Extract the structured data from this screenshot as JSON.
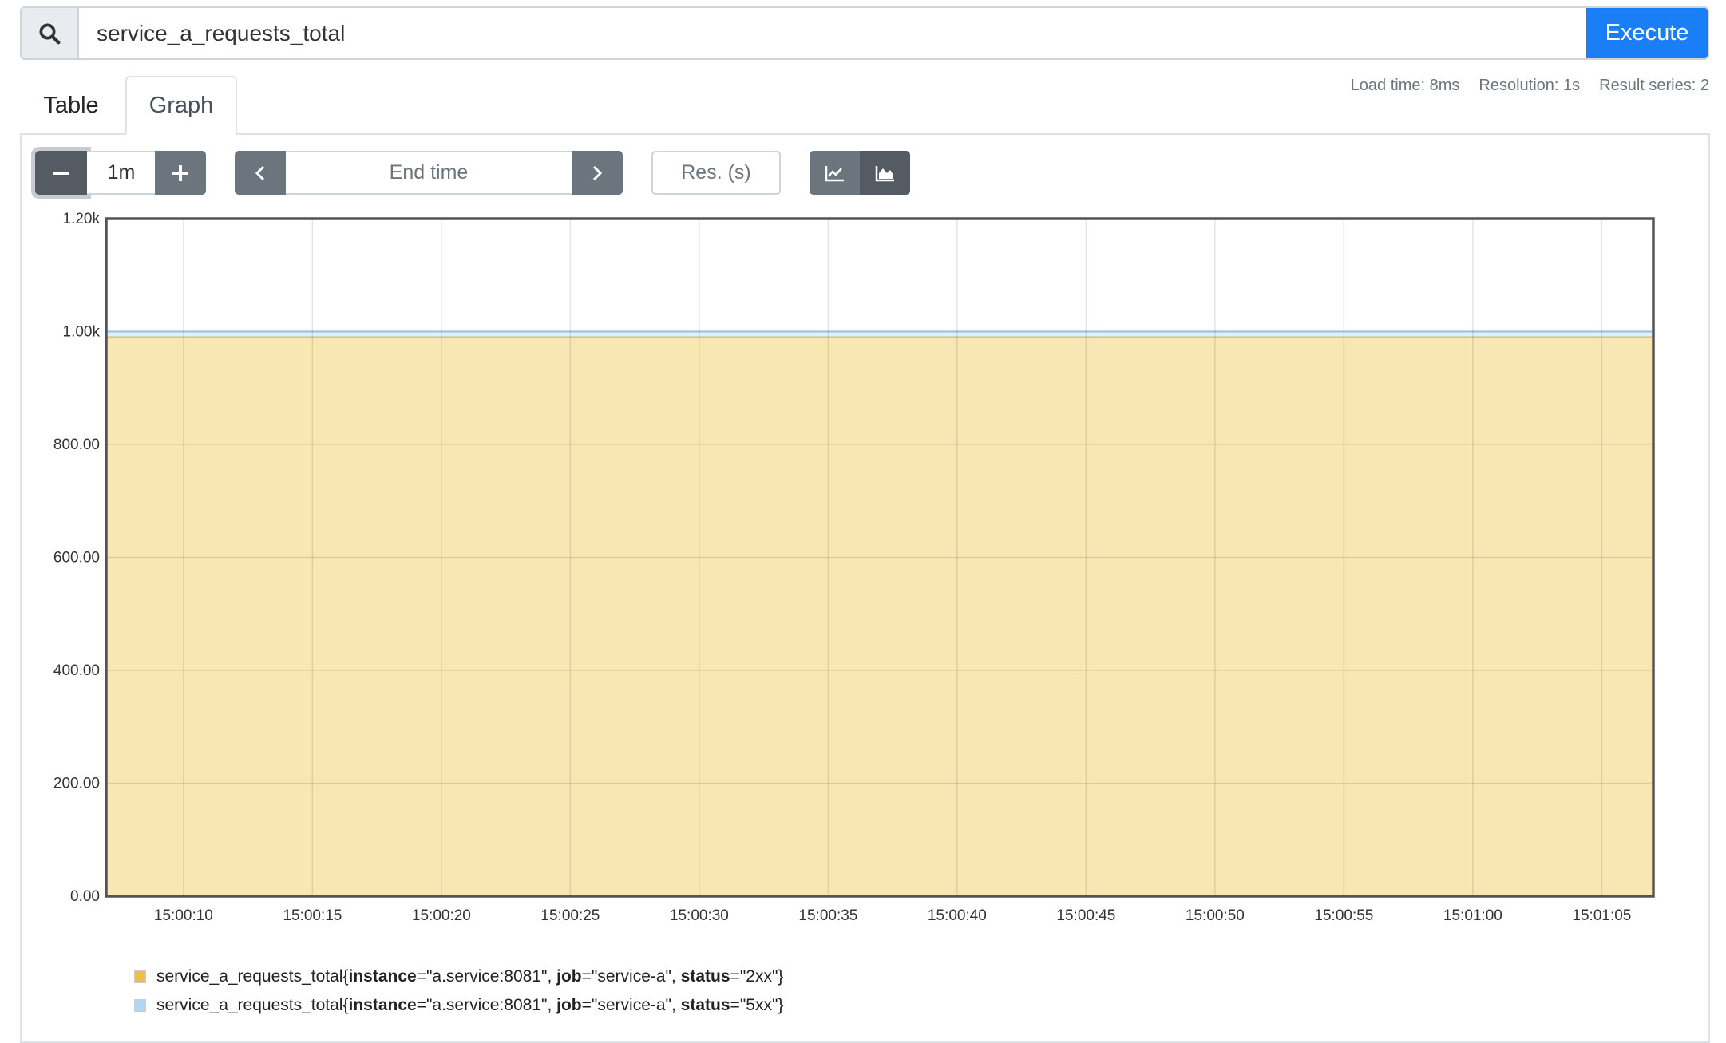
{
  "search": {
    "value": "service_a_requests_total",
    "icon": "search-icon",
    "execute_label": "Execute"
  },
  "tabs": [
    {
      "label": "Table"
    },
    {
      "label": "Graph",
      "active": true
    }
  ],
  "stats": {
    "load_time": "Load time: 8ms",
    "resolution": "Resolution: 1s",
    "result_series": "Result series: 2"
  },
  "controls": {
    "range": "1m",
    "end_time_placeholder": "End time",
    "resolution_placeholder": "Res. (s)",
    "chart_modes": [
      {
        "name": "line-chart-icon",
        "active": false
      },
      {
        "name": "stacked-area-chart-icon",
        "active": true
      }
    ]
  },
  "colors": {
    "primary": "#1a7ef7",
    "series_2xx": "#edc240",
    "series_5xx": "#afd8f8"
  },
  "chart_data": {
    "type": "area",
    "stacked": true,
    "xlim": [
      "15:00:07",
      "15:01:07"
    ],
    "ylim": [
      0,
      1200
    ],
    "grid": true,
    "legend_placement": "bottom-left",
    "y_ticks": [
      "0.00",
      "200.00",
      "400.00",
      "600.00",
      "800.00",
      "1.00k",
      "1.20k"
    ],
    "y_tick_values": [
      0,
      200,
      400,
      600,
      800,
      1000,
      1200
    ],
    "x_ticks": [
      "15:00:10",
      "15:00:15",
      "15:00:20",
      "15:00:25",
      "15:00:30",
      "15:00:35",
      "15:00:40",
      "15:00:45",
      "15:00:50",
      "15:00:55",
      "15:01:00",
      "15:01:05"
    ],
    "x": [
      "15:00:07",
      "15:01:07"
    ],
    "series": [
      {
        "metric": "service_a_requests_total",
        "labels": [
          {
            "k": "instance",
            "v": "\"a.service:8081\""
          },
          {
            "k": "job",
            "v": "\"service-a\""
          },
          {
            "k": "status",
            "v": "\"2xx\""
          }
        ],
        "color": "#edc240",
        "values": [
          990,
          990
        ]
      },
      {
        "metric": "service_a_requests_total",
        "labels": [
          {
            "k": "instance",
            "v": "\"a.service:8081\""
          },
          {
            "k": "job",
            "v": "\"service-a\""
          },
          {
            "k": "status",
            "v": "\"5xx\""
          }
        ],
        "color": "#afd8f8",
        "values": [
          10,
          10
        ]
      }
    ]
  }
}
